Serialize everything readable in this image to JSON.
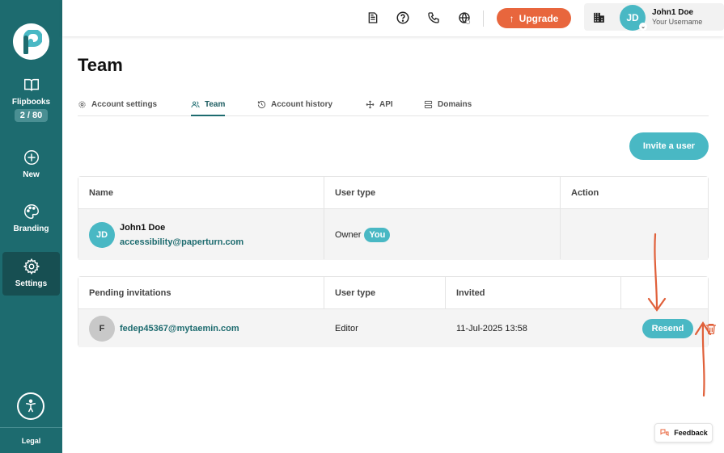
{
  "sidebar": {
    "items": [
      {
        "label": "Flipbooks",
        "badge": "2 / 80",
        "icon": "book-icon"
      },
      {
        "label": "New",
        "icon": "plus-circle-icon"
      },
      {
        "label": "Branding",
        "icon": "palette-icon"
      },
      {
        "label": "Settings",
        "icon": "gear-icon",
        "active": true
      }
    ],
    "legal": "Legal"
  },
  "topbar": {
    "upgrade_label": "Upgrade",
    "user_initials": "JD",
    "user_name": "John1 Doe",
    "user_sub": "Your Username"
  },
  "page": {
    "title": "Team"
  },
  "tabs": [
    {
      "label": "Account settings",
      "icon": "gear-icon"
    },
    {
      "label": "Team",
      "icon": "users-icon",
      "active": true
    },
    {
      "label": "Account history",
      "icon": "history-icon"
    },
    {
      "label": "API",
      "icon": "move-icon"
    },
    {
      "label": "Domains",
      "icon": "server-icon"
    }
  ],
  "invite_label": "Invite a user",
  "members_table": {
    "headers": [
      "Name",
      "User type",
      "Action"
    ],
    "rows": [
      {
        "initials": "JD",
        "name": "John1 Doe",
        "email": "accessibility@paperturn.com",
        "type": "Owner",
        "badge": "You"
      }
    ]
  },
  "pending_table": {
    "headers": [
      "Pending invitations",
      "User type",
      "Invited"
    ],
    "rows": [
      {
        "initial": "F",
        "email": "fedep45367@mytaemin.com",
        "type": "Editor",
        "invited": "11-Jul-2025 13:58",
        "action": "Resend"
      }
    ]
  },
  "feedback_label": "Feedback",
  "colors": {
    "sidebar": "#1d6b6f",
    "accent": "#49b8c4",
    "upgrade": "#e8663d",
    "annotation": "#e0603a"
  }
}
